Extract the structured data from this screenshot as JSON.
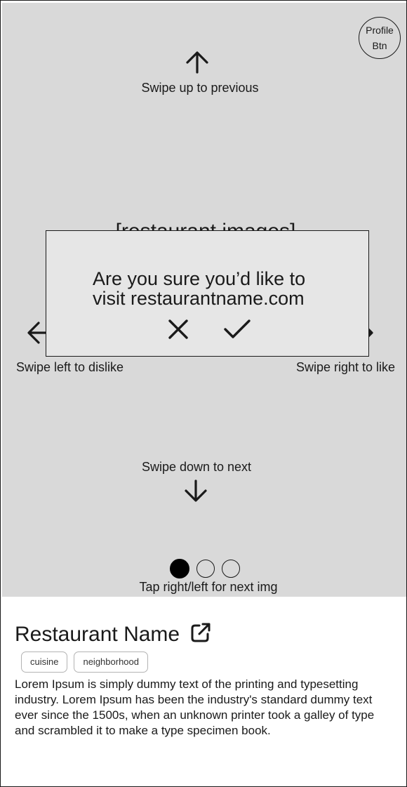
{
  "profile_button": {
    "line1": "Profile",
    "line2": "Btn"
  },
  "hints": {
    "up": "Swipe up to previous",
    "down": "Swipe down to next",
    "left": "Swipe left to dislike",
    "right": "Swipe right to like",
    "tap": "Tap right/left for next img"
  },
  "image_placeholder": "[restaurant images]",
  "carousel": {
    "total": 3,
    "active_index": 0
  },
  "modal": {
    "line1": "Are you sure you’d like to",
    "line2": "visit restaurantname.com",
    "cancel_icon": "close-icon",
    "confirm_icon": "check-icon"
  },
  "restaurant": {
    "name": "Restaurant Name",
    "tags": [
      "cuisine",
      "neighborhood"
    ],
    "description": "Lorem Ipsum is simply dummy text of the printing and typesetting industry. Lorem Ipsum has been the industry's standard dummy text ever since the 1500s, when an unknown printer took a galley of type and scrambled it to make a type specimen book."
  },
  "icons": {
    "up": "arrow-up-icon",
    "down": "arrow-down-icon",
    "left": "arrow-left-icon",
    "right": "arrow-right-icon",
    "external": "external-link-icon"
  },
  "colors": {
    "image_background": "#d9d9d9",
    "modal_background": "#e6e6e6",
    "text": "#1a1a1a",
    "tag_border": "#b3b3b3"
  }
}
